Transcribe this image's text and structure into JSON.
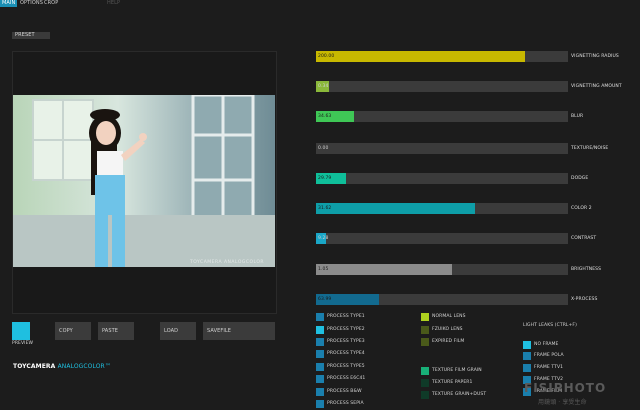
{
  "tabs": [
    {
      "label": "MAIN",
      "active": true
    },
    {
      "label": "OPTIONS",
      "active": false
    },
    {
      "label": "CROP",
      "active": false
    },
    {
      "label": "HELP",
      "active": false,
      "dim": true
    }
  ],
  "preset_label": "PRESET",
  "photo_caption": "TOYCAMERA ANALOGCOLOR",
  "sliders": [
    {
      "value": "200.00",
      "label": "VIGNETTING RADIUS",
      "fill": 0.83,
      "color": "#c7b800"
    },
    {
      "value": "0.34",
      "label": "VIGNETTING AMOUNT",
      "fill": 0.05,
      "color": "#8ab83a"
    },
    {
      "value": "34.63",
      "label": "BLUR",
      "fill": 0.15,
      "color": "#3fc756"
    },
    {
      "value": "0.00",
      "label": "TEXTURE/NOISE",
      "fill": 0.0,
      "color": "#3a3a3a"
    },
    {
      "value": "29.79",
      "label": "DODGE",
      "fill": 0.12,
      "color": "#0fbf9a"
    },
    {
      "value": "31.62",
      "label": "COLOR 2",
      "fill": 0.63,
      "color": "#0e9ea8"
    },
    {
      "value": "9.28",
      "label": "CONTRAST",
      "fill": 0.04,
      "color": "#1aa7c7"
    },
    {
      "value": "1.05",
      "label": "BRIGHTNESS",
      "fill": 0.54,
      "color": "#8b8b8b"
    },
    {
      "value": "63.99",
      "label": "X-PROCESS",
      "fill": 0.25,
      "color": "#126a8f"
    }
  ],
  "buttons": {
    "preview": "PREVIEW",
    "copy": "COPY",
    "paste": "PASTE",
    "load": "LOAD",
    "savefile": "SAVEFILE"
  },
  "process_options": [
    {
      "label": "PROCESS TYPE1",
      "color": "#1a7fad"
    },
    {
      "label": "PROCESS TYPE2",
      "color": "#1fbfe0"
    },
    {
      "label": "PROCESS TYPE3",
      "color": "#1a7fad"
    },
    {
      "label": "PROCESS TYPE4",
      "color": "#1a7fad"
    },
    {
      "label": "PROCESS TYPE5",
      "color": "#1a7fad"
    },
    {
      "label": "PROCESS E6C41",
      "color": "#1a7fad"
    },
    {
      "label": "PROCESS B&W",
      "color": "#1a7fad"
    },
    {
      "label": "PROCESS SEPIA",
      "color": "#1a7fad"
    }
  ],
  "lens_options": [
    {
      "label": "NORMAL LENS",
      "color": "#aed11f"
    },
    {
      "label": "FZUIKO LENS",
      "color": "#4a5a1a"
    },
    {
      "label": "EXPIRED FILM",
      "color": "#4a5a1a"
    }
  ],
  "texture_options": [
    {
      "label": "TEXTURE FILM GRAIN",
      "color": "#18b078"
    },
    {
      "label": "TEXTURE PAPER1",
      "color": "#0f3a28"
    },
    {
      "label": "TEXTURE GRAIN+DUST",
      "color": "#0f3a28"
    }
  ],
  "light_leaks_label": "LIGHT LEAKS (CTRL+F)",
  "frame_options": [
    {
      "label": "NO FRAME",
      "color": "#1fbfe0"
    },
    {
      "label": "FRAME POLA",
      "color": "#1a7fad"
    },
    {
      "label": "FRAME TTV1",
      "color": "#1a7fad"
    },
    {
      "label": "FRAME TTV2",
      "color": "#1a7fad"
    },
    {
      "label": "FRAME FILM",
      "color": "#1a7fad"
    }
  ],
  "logo": {
    "main": "TOYCAMERA",
    "accent": "ANALOGCOLOR™"
  },
  "watermark": {
    "main": "FISIPHOTO",
    "sub": "用鏡頭 · 享受生命"
  }
}
